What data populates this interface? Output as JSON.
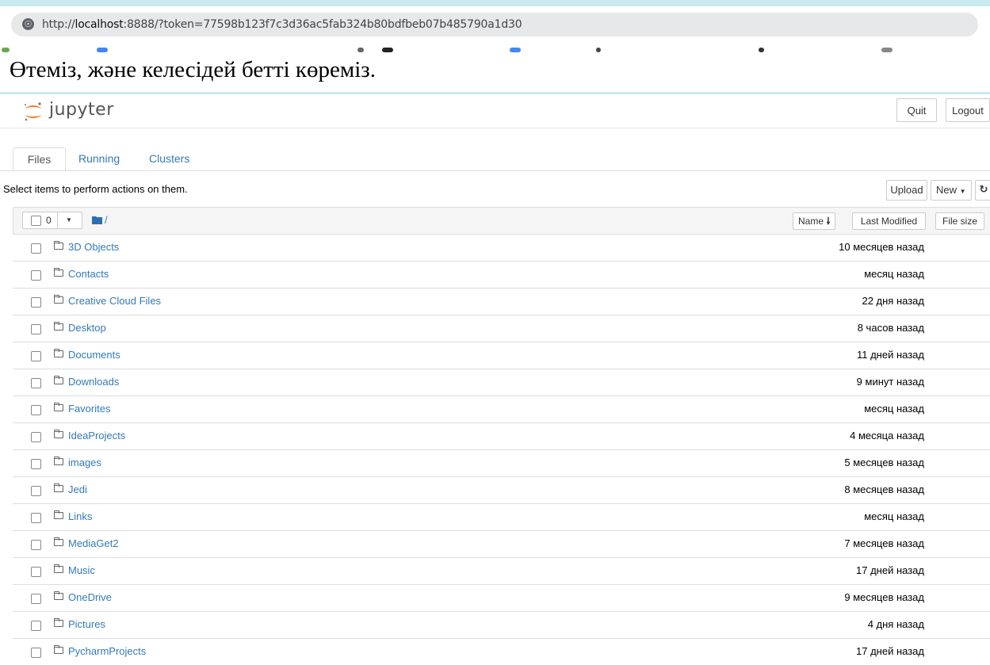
{
  "browser": {
    "url_prefix": "http://",
    "url_host": "localhost",
    "url_rest": ":8888/?token=77598b123f7c3d36ac5fab324b80bdfbeb07b485790a1d30"
  },
  "caption": "Өтеміз, және келесідей бетті көреміз.",
  "header": {
    "logo_text": "jupyter",
    "quit_label": "Quit",
    "logout_label": "Logout"
  },
  "tabs": [
    {
      "label": "Files"
    },
    {
      "label": "Running"
    },
    {
      "label": "Clusters"
    }
  ],
  "toolbar": {
    "select_message": "Select items to perform actions on them.",
    "upload_label": "Upload",
    "new_label": "New",
    "selected_count": "0",
    "breadcrumb": "/",
    "sort_name_label": "Name",
    "last_modified_label": "Last Modified",
    "file_size_label": "File size"
  },
  "files": [
    {
      "name": "3D Objects",
      "modified": "10 месяцев назад"
    },
    {
      "name": "Contacts",
      "modified": "месяц назад"
    },
    {
      "name": "Creative Cloud Files",
      "modified": "22 дня назад"
    },
    {
      "name": "Desktop",
      "modified": "8 часов назад"
    },
    {
      "name": "Documents",
      "modified": "11 дней назад"
    },
    {
      "name": "Downloads",
      "modified": "9 минут назад"
    },
    {
      "name": "Favorites",
      "modified": "месяц назад"
    },
    {
      "name": "IdeaProjects",
      "modified": "4 месяца назад"
    },
    {
      "name": "images",
      "modified": "5 месяцев назад"
    },
    {
      "name": "Jedi",
      "modified": "8 месяцев назад"
    },
    {
      "name": "Links",
      "modified": "месяц назад"
    },
    {
      "name": "MediaGet2",
      "modified": "7 месяцев назад"
    },
    {
      "name": "Music",
      "modified": "17 дней назад"
    },
    {
      "name": "OneDrive",
      "modified": "9 месяцев назад"
    },
    {
      "name": "Pictures",
      "modified": "4 дня назад"
    },
    {
      "name": "PycharmProjects",
      "modified": "17 дней назад"
    }
  ],
  "colors": {
    "link": "#337ab7",
    "jupyter_orange": "#f37726"
  }
}
